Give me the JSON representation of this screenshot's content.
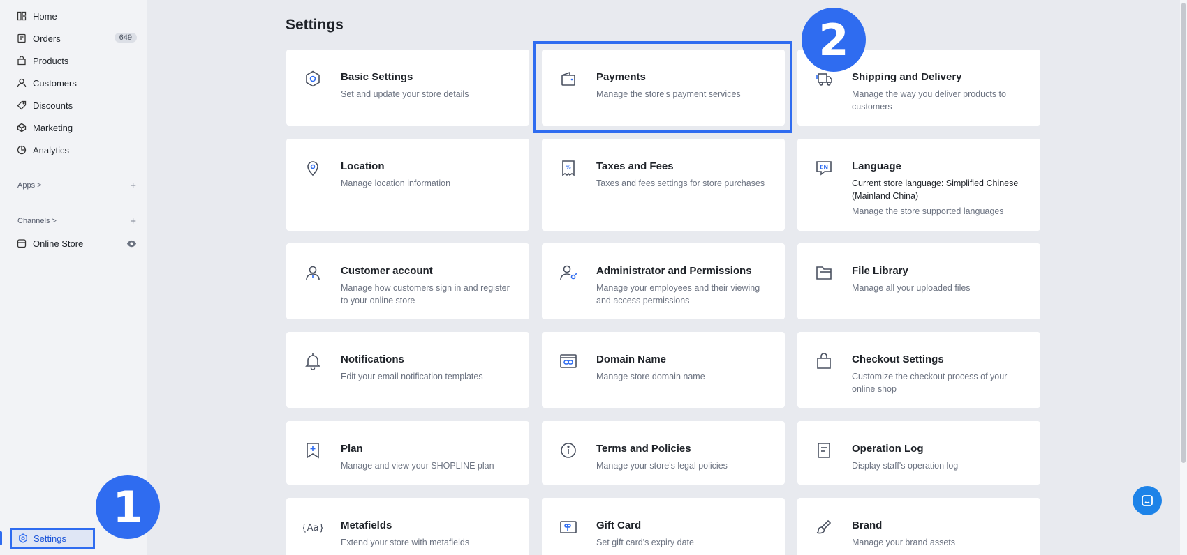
{
  "sidebar": {
    "items": [
      {
        "label": "Home",
        "icon": "home-icon"
      },
      {
        "label": "Orders",
        "icon": "orders-icon",
        "badge": "649"
      },
      {
        "label": "Products",
        "icon": "products-icon"
      },
      {
        "label": "Customers",
        "icon": "customers-icon"
      },
      {
        "label": "Discounts",
        "icon": "discounts-icon"
      },
      {
        "label": "Marketing",
        "icon": "marketing-icon"
      },
      {
        "label": "Analytics",
        "icon": "analytics-icon"
      }
    ],
    "apps_label": "Apps >",
    "channels_label": "Channels >",
    "plus": "+",
    "online_store": "Online Store",
    "settings_label": "Settings"
  },
  "markers": {
    "step1": "1",
    "step2": "2"
  },
  "accent_color": "#2f6cf0",
  "main": {
    "title": "Settings",
    "cards": [
      {
        "title": "Basic Settings",
        "desc": "Set and update your store details",
        "icon": "gear-icon"
      },
      {
        "title": "Payments",
        "desc": "Manage the store's payment services",
        "icon": "wallet-icon"
      },
      {
        "title": "Shipping and Delivery",
        "desc": "Manage the way you deliver products to customers",
        "icon": "truck-icon"
      },
      {
        "title": "Location",
        "desc": "Manage location information",
        "icon": "location-pin-icon"
      },
      {
        "title": "Taxes and Fees",
        "desc": "Taxes and fees settings for store purchases",
        "icon": "receipt-icon"
      },
      {
        "title": "Language",
        "strong": "Current store language: Simplified Chinese (Mainland China)",
        "desc": "Manage the store supported languages",
        "icon": "language-icon"
      },
      {
        "title": "Customer account",
        "desc": "Manage how customers sign in and register to your online store",
        "icon": "user-icon"
      },
      {
        "title": "Administrator and Permissions",
        "desc": "Manage your employees and their viewing and access permissions",
        "icon": "admin-key-icon"
      },
      {
        "title": "File Library",
        "desc": "Manage all your uploaded files",
        "icon": "folder-icon"
      },
      {
        "title": "Notifications",
        "desc": "Edit your email notification templates",
        "icon": "bell-icon"
      },
      {
        "title": "Domain Name",
        "desc": "Manage store domain name",
        "icon": "domain-link-icon"
      },
      {
        "title": "Checkout Settings",
        "desc": "Customize the checkout process of your online shop",
        "icon": "shopping-bag-icon"
      },
      {
        "title": "Plan",
        "desc": "Manage and view your SHOPLINE plan",
        "icon": "plan-bookmark-icon"
      },
      {
        "title": "Terms and Policies",
        "desc": "Manage your store's legal policies",
        "icon": "info-icon"
      },
      {
        "title": "Operation Log",
        "desc": "Display staff's operation log",
        "icon": "log-icon"
      },
      {
        "title": "Metafields",
        "desc": "Extend your store with metafields",
        "icon": "metafields-icon"
      },
      {
        "title": "Gift Card",
        "desc": "Set gift card's expiry date",
        "icon": "gift-card-icon"
      },
      {
        "title": "Brand",
        "desc": "Manage your brand assets",
        "icon": "brand-brush-icon"
      }
    ]
  }
}
